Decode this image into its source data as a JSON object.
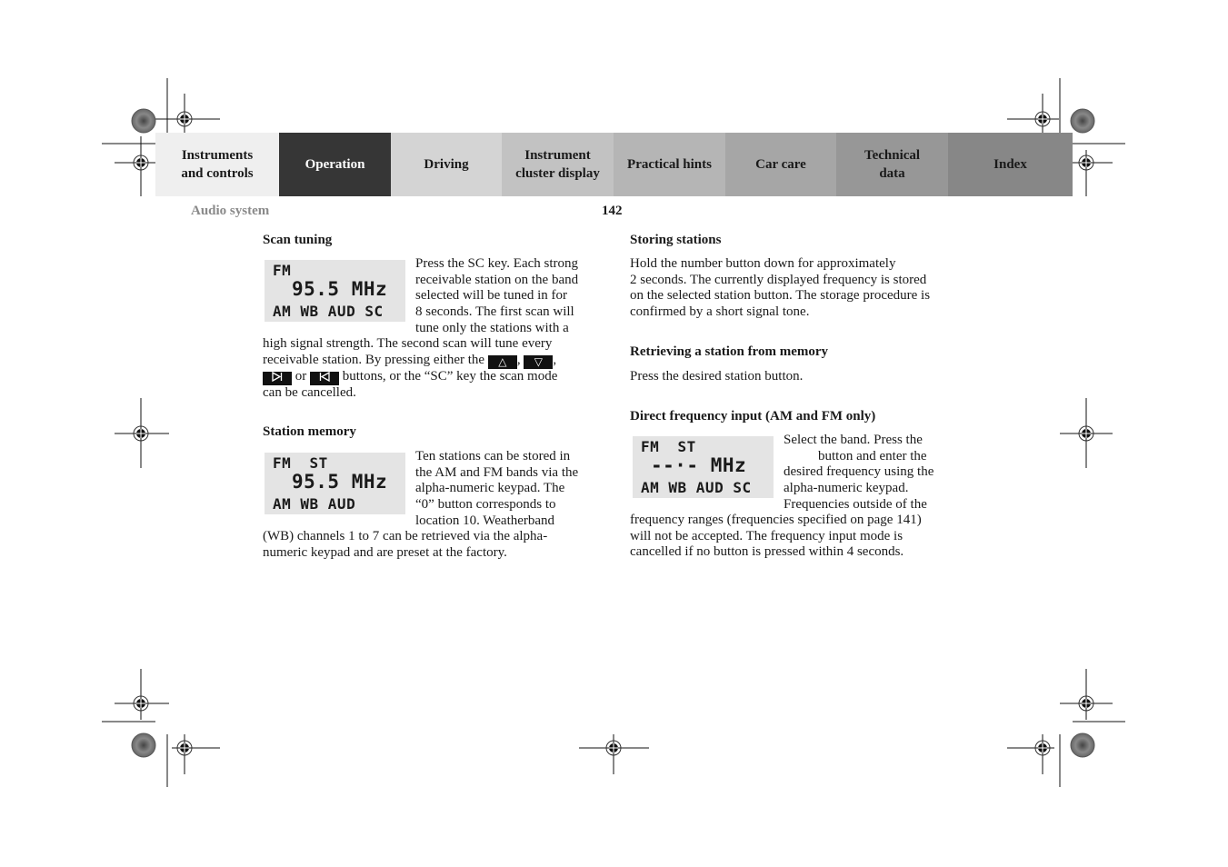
{
  "nav": {
    "tabs": [
      {
        "label": "Instruments\nand controls",
        "bg": "#efefef",
        "fg": "#1a1a1a",
        "active": false
      },
      {
        "label": "Operation",
        "bg": "#363636",
        "fg": "#ffffff",
        "active": true
      },
      {
        "label": "Driving",
        "bg": "#d4d4d4",
        "fg": "#1a1a1a",
        "active": false
      },
      {
        "label": "Instrument\ncluster display",
        "bg": "#c2c2c2",
        "fg": "#1a1a1a",
        "active": false
      },
      {
        "label": "Practical hints",
        "bg": "#b5b5b5",
        "fg": "#1a1a1a",
        "active": false
      },
      {
        "label": "Car care",
        "bg": "#a6a6a6",
        "fg": "#1a1a1a",
        "active": false
      },
      {
        "label": "Technical\ndata",
        "bg": "#979797",
        "fg": "#1a1a1a",
        "active": false
      },
      {
        "label": "Index",
        "bg": "#878787",
        "fg": "#1a1a1a",
        "active": false
      }
    ]
  },
  "header": {
    "section": "Audio system",
    "page_number": "142"
  },
  "left_column": {
    "scan_tuning": {
      "heading": "Scan tuning",
      "display": {
        "row1": "FM",
        "row2": "95.5 MHz",
        "row3": "AM WB AUD SC"
      },
      "side_lines": [
        "Press the SC key. Each strong",
        "receivable station on the band",
        "selected will be tuned in for",
        "8 seconds. The first scan will",
        "tune only the stations with a"
      ],
      "full_line_1": "high signal strength. The second scan will tune every",
      "full_line_2_prefix": "receivable station. By pressing either the",
      "key_up": "△",
      "key_down": "▽",
      "key_next": "⊳|",
      "key_prev": "|⊲",
      "or_text": "or",
      "full_line_3_suffix": "buttons, or the “SC” key the scan mode",
      "full_line_4": "can be cancelled."
    },
    "station_memory": {
      "heading": "Station memory",
      "display": {
        "row1": "FM  ST",
        "row2": "95.5 MHz",
        "row3": "AM WB AUD"
      },
      "side_lines": [
        "Ten stations can be stored in",
        "the AM and FM bands via the",
        "alpha-numeric keypad. The",
        "“0” button corresponds to",
        "location 10. Weatherband"
      ],
      "full_lines": [
        "(WB) channels 1 to 7 can be retrieved via the alpha-",
        "numeric keypad and are preset at the factory."
      ]
    }
  },
  "right_column": {
    "storing_stations": {
      "heading": "Storing stations",
      "lines": [
        "Hold the number button down for approximately",
        "2 seconds. The currently displayed frequency is stored",
        "on the selected station button. The storage procedure is",
        "confirmed by a short signal tone."
      ]
    },
    "retrieving": {
      "heading": "Retrieving a station from memory",
      "lines": [
        "Press the desired station button."
      ]
    },
    "direct_input": {
      "heading": "Direct frequency input (AM and FM only)",
      "display": {
        "row1": "FM  ST",
        "row2": "--·- MHz",
        "row3": "AM WB AUD SC"
      },
      "side_lines": [
        "Select the band. Press the",
        "button and enter the",
        "desired frequency using the",
        "alpha-numeric keypad.",
        "Frequencies outside of the"
      ],
      "full_lines": [
        "frequency ranges (frequencies specified on page 141)",
        "will not be accepted. The frequency input mode is",
        "cancelled if no button is pressed within 4 seconds."
      ]
    }
  }
}
